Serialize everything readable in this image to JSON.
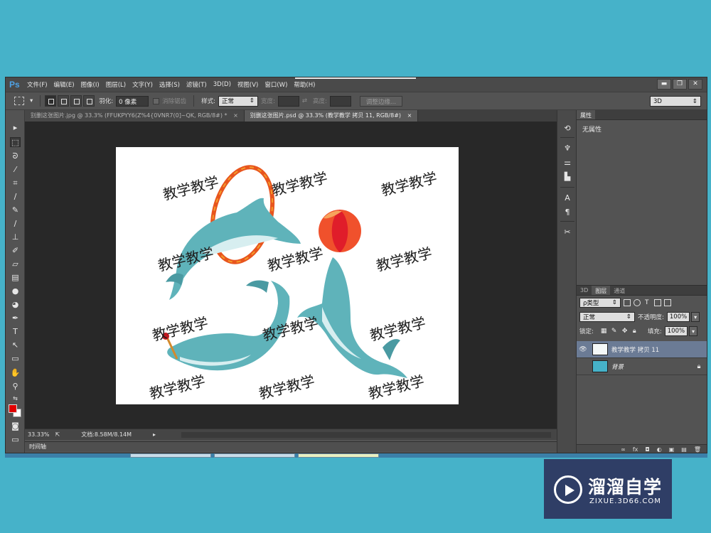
{
  "app": {
    "logo": "Ps"
  },
  "menu": [
    "文件(F)",
    "编辑(E)",
    "图像(I)",
    "图层(L)",
    "文字(Y)",
    "选择(S)",
    "滤镜(T)",
    "3D(D)",
    "视图(V)",
    "窗口(W)",
    "帮助(H)"
  ],
  "window_controls": {
    "minimize": "▬",
    "restore": "❐",
    "close": "✕"
  },
  "options": {
    "feather_label": "羽化:",
    "feather_value": "0 像素",
    "antialias_label": "消除锯齿",
    "style_label": "样式:",
    "style_value": "正常",
    "width_label": "宽度:",
    "height_label": "高度:",
    "refine_button": "调整边缘...",
    "workspace_value": "3D"
  },
  "tabs": [
    {
      "label": "别删这张图片.jpg @ 33.3% (FFUKPYY6(Z%4{0VNR7(0]~QK, RGB/8#) *",
      "close": "×"
    },
    {
      "label": "别删这张图片.psd @ 33.3% (教学教学 拷贝 11, RGB/8#)",
      "close": "×"
    }
  ],
  "watermark": "教学教学",
  "status": {
    "zoom": "33.33%",
    "doc_info": "文档:8.58M/8.14M"
  },
  "timeline_label": "时间轴",
  "properties": {
    "tab": "属性",
    "body": "无属性"
  },
  "layers": {
    "tabs": [
      "3D",
      "图层",
      "通道"
    ],
    "filter_kind": "ρ类型",
    "blend_mode": "正常",
    "opacity_label": "不透明度:",
    "opacity_value": "100%",
    "lock_label": "锁定:",
    "fill_label": "填充:",
    "fill_value": "100%",
    "items": [
      {
        "name": "教学教学 拷贝 11",
        "visible": true,
        "selected": true
      },
      {
        "name": "背景",
        "visible": false,
        "selected": false
      }
    ],
    "footer_icons": [
      "∞",
      "fx",
      "◘",
      "◐",
      "▣",
      "▤",
      "🗑"
    ]
  },
  "brand": {
    "name": "溜溜自学",
    "url": "ZIXUE.3D66.COM"
  },
  "colors": {
    "foreground": "#e00000",
    "background": "#ffffff",
    "page_bg": "#46b2c9",
    "brand_bg": "#2f3e66"
  }
}
